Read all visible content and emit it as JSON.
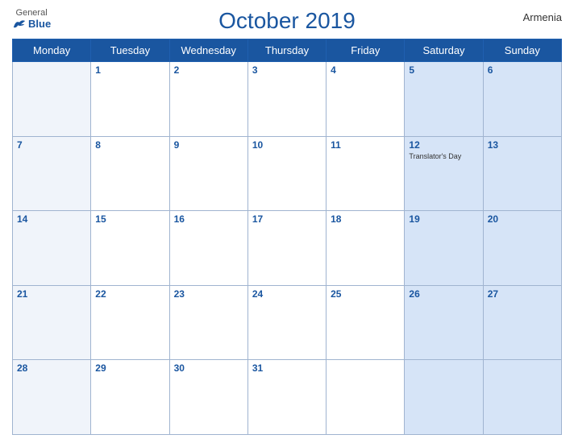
{
  "header": {
    "logo_general": "General",
    "logo_blue": "Blue",
    "title": "October 2019",
    "country": "Armenia"
  },
  "weekdays": [
    "Monday",
    "Tuesday",
    "Wednesday",
    "Thursday",
    "Friday",
    "Saturday",
    "Sunday"
  ],
  "weeks": [
    [
      {
        "day": "",
        "event": ""
      },
      {
        "day": "1",
        "event": ""
      },
      {
        "day": "2",
        "event": ""
      },
      {
        "day": "3",
        "event": ""
      },
      {
        "day": "4",
        "event": ""
      },
      {
        "day": "5",
        "event": ""
      },
      {
        "day": "6",
        "event": ""
      }
    ],
    [
      {
        "day": "7",
        "event": ""
      },
      {
        "day": "8",
        "event": ""
      },
      {
        "day": "9",
        "event": ""
      },
      {
        "day": "10",
        "event": ""
      },
      {
        "day": "11",
        "event": ""
      },
      {
        "day": "12",
        "event": "Translator's Day"
      },
      {
        "day": "13",
        "event": ""
      }
    ],
    [
      {
        "day": "14",
        "event": ""
      },
      {
        "day": "15",
        "event": ""
      },
      {
        "day": "16",
        "event": ""
      },
      {
        "day": "17",
        "event": ""
      },
      {
        "day": "18",
        "event": ""
      },
      {
        "day": "19",
        "event": ""
      },
      {
        "day": "20",
        "event": ""
      }
    ],
    [
      {
        "day": "21",
        "event": ""
      },
      {
        "day": "22",
        "event": ""
      },
      {
        "day": "23",
        "event": ""
      },
      {
        "day": "24",
        "event": ""
      },
      {
        "day": "25",
        "event": ""
      },
      {
        "day": "26",
        "event": ""
      },
      {
        "day": "27",
        "event": ""
      }
    ],
    [
      {
        "day": "28",
        "event": ""
      },
      {
        "day": "29",
        "event": ""
      },
      {
        "day": "30",
        "event": ""
      },
      {
        "day": "31",
        "event": ""
      },
      {
        "day": "",
        "event": ""
      },
      {
        "day": "",
        "event": ""
      },
      {
        "day": "",
        "event": ""
      }
    ]
  ],
  "col_classes": [
    "col-monday",
    "col-other",
    "col-other",
    "col-other",
    "col-other",
    "col-saturday",
    "col-sunday"
  ]
}
